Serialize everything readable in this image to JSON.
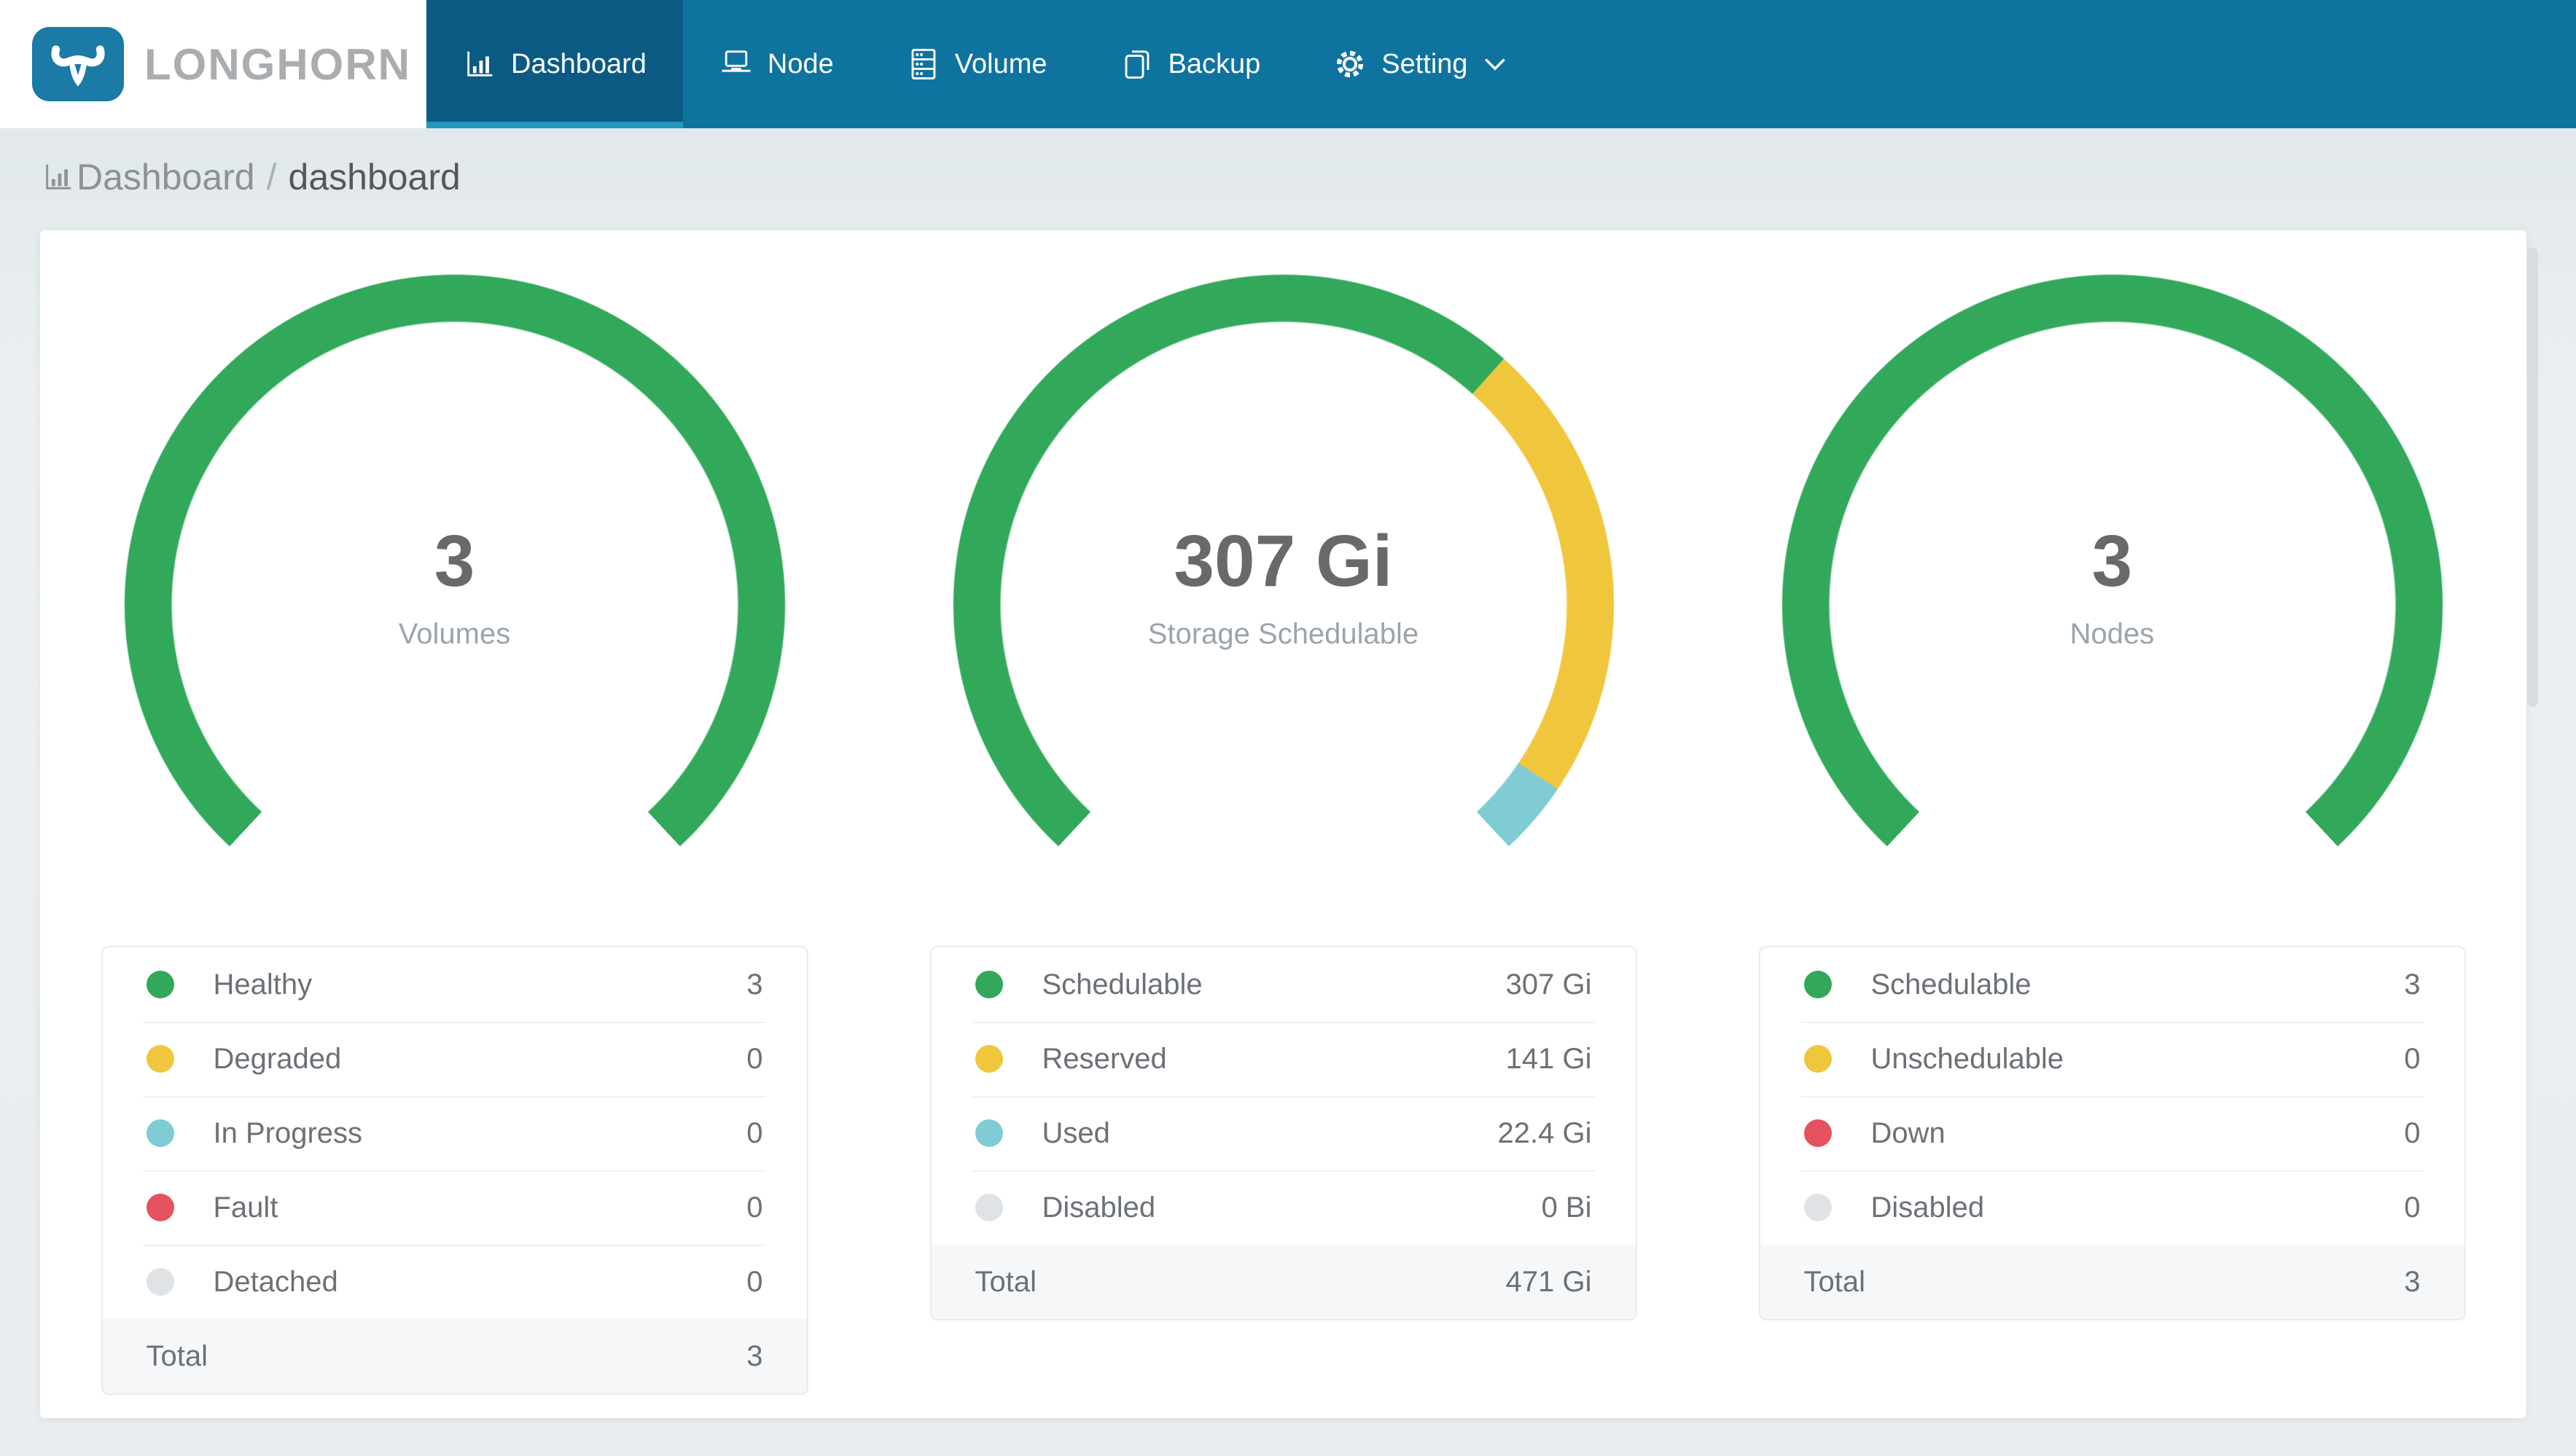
{
  "header": {
    "brand_name": "LONGHORN",
    "nav": [
      {
        "label": "Dashboard",
        "icon": "bar-chart-icon",
        "active": true
      },
      {
        "label": "Node",
        "icon": "laptop-icon",
        "active": false
      },
      {
        "label": "Volume",
        "icon": "storage-rack-icon",
        "active": false
      },
      {
        "label": "Backup",
        "icon": "copy-document-icon",
        "active": false
      },
      {
        "label": "Setting",
        "icon": "gear-icon",
        "active": false,
        "has_dropdown": true
      }
    ]
  },
  "breadcrumb": {
    "section": "Dashboard",
    "separator": "/",
    "page": "dashboard",
    "icon": "bar-chart-icon"
  },
  "colors": {
    "nav_bg": "#0f73a0",
    "nav_active_bg": "#0b5a84",
    "nav_active_underline": "#2299bd",
    "brand_icon_bg": "#1b7aa6",
    "brand_text": "#a9adb0",
    "green": "#31a85a",
    "yellow": "#f0c63c",
    "teal": "#7fccd4",
    "red": "#e4525f",
    "gray": "#dfe3e6",
    "page_bg": "#e9eef0",
    "card_bg": "#ffffff"
  },
  "chart_data": [
    {
      "type": "donut",
      "title": "Volumes",
      "center_value": "3",
      "center_label": "Volumes",
      "arc": {
        "start_deg": 223,
        "span_deg": 274,
        "outer_radius_px": 454,
        "thickness_px": 66
      },
      "segments": [
        {
          "label": "Healthy",
          "value": 3,
          "display": "3",
          "color": "#31a85a"
        },
        {
          "label": "Degraded",
          "value": 0,
          "display": "0",
          "color": "#f0c63c"
        },
        {
          "label": "In Progress",
          "value": 0,
          "display": "0",
          "color": "#7fccd4"
        },
        {
          "label": "Fault",
          "value": 0,
          "display": "0",
          "color": "#e4525f"
        },
        {
          "label": "Detached",
          "value": 0,
          "display": "0",
          "color": "#dfe3e6"
        }
      ],
      "total": {
        "label": "Total",
        "display": "3"
      }
    },
    {
      "type": "donut",
      "title": "Storage Schedulable",
      "center_value": "307 Gi",
      "center_label": "Storage Schedulable",
      "arc": {
        "start_deg": 223,
        "span_deg": 274,
        "outer_radius_px": 454,
        "thickness_px": 66
      },
      "segments": [
        {
          "label": "Schedulable",
          "value": 307,
          "display": "307 Gi",
          "color": "#31a85a"
        },
        {
          "label": "Reserved",
          "value": 141,
          "display": "141 Gi",
          "color": "#f0c63c"
        },
        {
          "label": "Used",
          "value": 22.4,
          "display": "22.4 Gi",
          "color": "#7fccd4"
        },
        {
          "label": "Disabled",
          "value": 0,
          "display": "0 Bi",
          "color": "#dfe3e6"
        }
      ],
      "total": {
        "label": "Total",
        "display": "471 Gi"
      }
    },
    {
      "type": "donut",
      "title": "Nodes",
      "center_value": "3",
      "center_label": "Nodes",
      "arc": {
        "start_deg": 223,
        "span_deg": 274,
        "outer_radius_px": 454,
        "thickness_px": 66
      },
      "segments": [
        {
          "label": "Schedulable",
          "value": 3,
          "display": "3",
          "color": "#31a85a"
        },
        {
          "label": "Unschedulable",
          "value": 0,
          "display": "0",
          "color": "#f0c63c"
        },
        {
          "label": "Down",
          "value": 0,
          "display": "0",
          "color": "#e4525f"
        },
        {
          "label": "Disabled",
          "value": 0,
          "display": "0",
          "color": "#dfe3e6"
        }
      ],
      "total": {
        "label": "Total",
        "display": "3"
      }
    }
  ]
}
